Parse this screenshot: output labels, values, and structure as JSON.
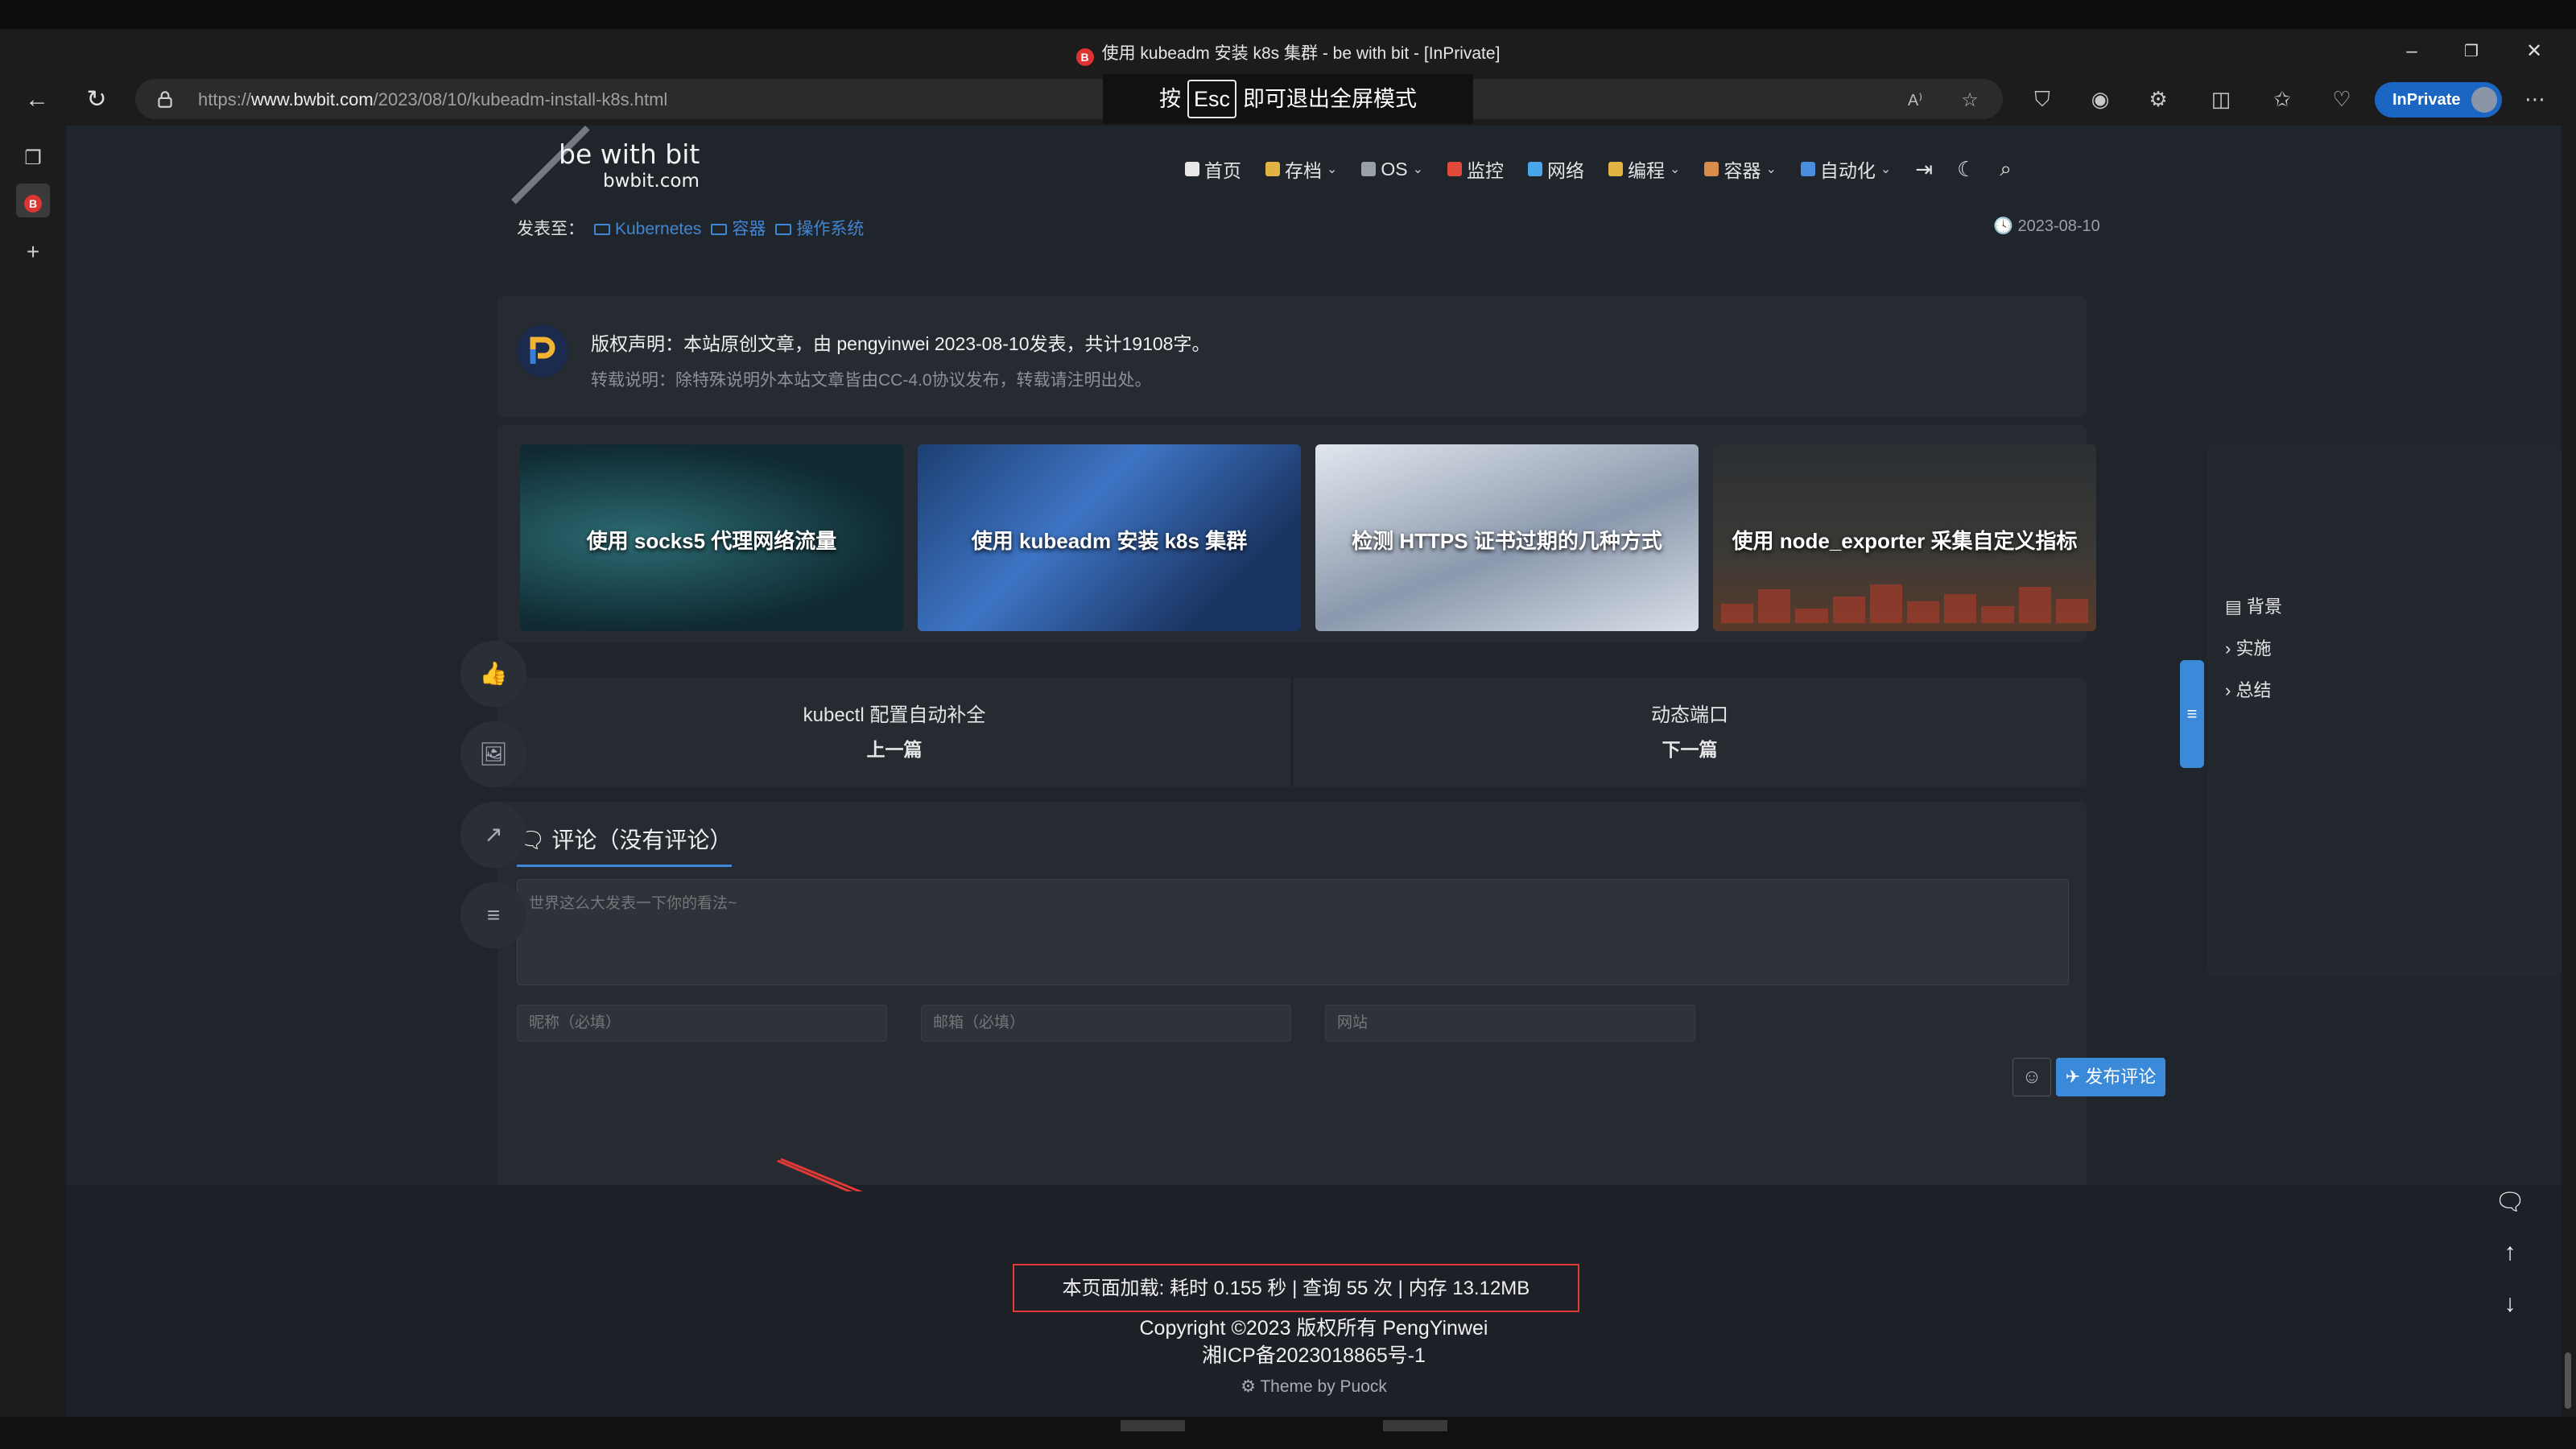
{
  "browser": {
    "tab_title": "使用 kubeadm 安装 k8s 集群 - be with bit - [InPrivate]",
    "url_prefix": "https://",
    "url_host": "www.bwbit.com",
    "url_path": "/2023/08/10/kubeadm-install-k8s.html",
    "inprivate_label": "InPrivate",
    "favicon_letter": "B",
    "fullscreen_hint": {
      "before": "按",
      "key": "Esc",
      "after": "即可退出全屏模式"
    }
  },
  "site": {
    "logo_main": "be with bit",
    "logo_sub": "bwbit.com",
    "nav": [
      {
        "label": "首页",
        "color": "#e8e8e8",
        "dropdown": false
      },
      {
        "label": "存档",
        "color": "#e0b342",
        "dropdown": true
      },
      {
        "label": "OS",
        "color": "#9aa0a8",
        "dropdown": true
      },
      {
        "label": "监控",
        "color": "#e24a3b",
        "dropdown": false
      },
      {
        "label": "网络",
        "color": "#49a6e8",
        "dropdown": false
      },
      {
        "label": "编程",
        "color": "#e0b342",
        "dropdown": true
      },
      {
        "label": "容器",
        "color": "#d98c4a",
        "dropdown": true
      },
      {
        "label": "自动化",
        "color": "#4a8ee0",
        "dropdown": true
      }
    ]
  },
  "article": {
    "posted_to_label": "发表至：",
    "categories": [
      "Kubernetes",
      "容器",
      "操作系统"
    ],
    "date": "2023-08-10",
    "copyright_line1": "版权声明：本站原创文章，由 pengyinwei 2023-08-10发表，共计19108字。",
    "copyright_line2": "转载说明：除特殊说明外本站文章皆由CC-4.0协议发布，转载请注明出处。",
    "related": [
      "使用 socks5 代理网络流量",
      "使用 kubeadm 安装 k8s 集群",
      "检测 HTTPS 证书过期的几种方式",
      "使用 node_exporter 采集自定义指标"
    ],
    "prev": {
      "title": "kubectl 配置自动补全",
      "label": "上一篇"
    },
    "next": {
      "title": "动态端口",
      "label": "下一篇"
    }
  },
  "comments": {
    "title": "评论（没有评论）",
    "textarea_placeholder": "世界这么大发表一下你的看法~",
    "name_placeholder": "昵称（必填）",
    "email_placeholder": "邮箱（必填）",
    "site_placeholder": "网站",
    "submit_label": "发布评论"
  },
  "toc": [
    "背景",
    "实施",
    "总结"
  ],
  "footer": {
    "load_stats": "本页面加载: 耗时 0.155 秒 | 查询 55 次 | 内存 13.12MB",
    "copyright": "Copyright ©2023 版权所有 PengYinwei",
    "icp": "湘ICP备2023018865号-1",
    "theme": "Theme by Puock"
  }
}
